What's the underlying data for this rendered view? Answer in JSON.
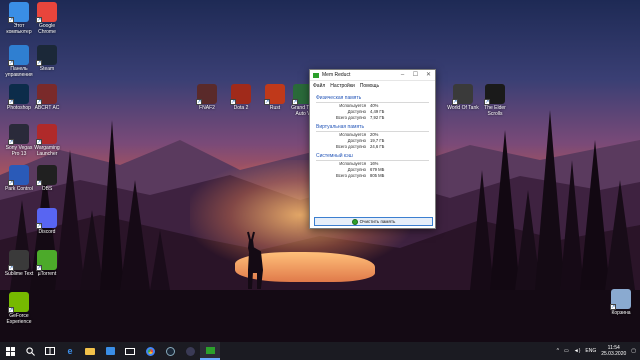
{
  "desktop_icons": [
    {
      "label": "Этот компьютер",
      "color": "#3a8ee6"
    },
    {
      "label": "Google Chrome",
      "color": "#e8453c"
    },
    {
      "label": "Панель управления",
      "color": "#2f7fd1"
    },
    {
      "label": "Steam",
      "color": "#1b2838"
    },
    {
      "label": "Photoshop",
      "color": "#0c2c4a"
    },
    {
      "label": "ABCRT AC",
      "color": "#7a2a2a"
    },
    {
      "label": "Sony Vegas Pro 13",
      "color": "#2a2a3a"
    },
    {
      "label": "Wargaming Launcher",
      "color": "#b02a2a"
    },
    {
      "label": "Park Control",
      "color": "#2a5ab8"
    },
    {
      "label": "OBS",
      "color": "#202020"
    },
    {
      "label": "Discord",
      "color": "#5865f2"
    },
    {
      "label": "Sublime Text",
      "color": "#3a3a3a"
    },
    {
      "label": "µTorrent",
      "color": "#4caa2a"
    },
    {
      "label": "GeForce Experience",
      "color": "#76b900"
    },
    {
      "label": "FNAF2",
      "color": "#5a2a2a"
    },
    {
      "label": "Dota 2",
      "color": "#a02a1a"
    },
    {
      "label": "Rust",
      "color": "#c0391a"
    },
    {
      "label": "Grand The Auto V",
      "color": "#2a6a3a"
    },
    {
      "label": "World Of Tank",
      "color": "#3a3a3a"
    },
    {
      "label": "The Elder Scrolls",
      "color": "#1a1a1a"
    },
    {
      "label": "Корзина",
      "color": "#8aaad0"
    }
  ],
  "window": {
    "title": "Mem Reduct",
    "minimize": "–",
    "maximize": "☐",
    "close": "✕",
    "menu": [
      "Файл",
      "Настройки",
      "Помощь"
    ],
    "sections": [
      {
        "title": "Физическая память",
        "rows": [
          {
            "label": "Используется",
            "value": "40%"
          },
          {
            "label": "Доступно",
            "value": "4,49 ГБ"
          },
          {
            "label": "Всего доступно",
            "value": "7,92 ГБ"
          }
        ]
      },
      {
        "title": "Виртуальная память",
        "rows": [
          {
            "label": "Используется",
            "value": "20%"
          },
          {
            "label": "Доступно",
            "value": "19,7 ГБ"
          },
          {
            "label": "Всего доступно",
            "value": "24,6 ГБ"
          }
        ]
      },
      {
        "title": "Системный кэш",
        "rows": [
          {
            "label": "Используется",
            "value": "16%"
          },
          {
            "label": "Доступно",
            "value": "679 МБ"
          },
          {
            "label": "Всего доступно",
            "value": "805 МБ"
          }
        ]
      }
    ],
    "clear_button": "Очистить память"
  },
  "taskbar": {
    "start_icon": "windows-start-icon",
    "lang": "ENG",
    "time": "11:54",
    "date": "25.03.2020"
  }
}
